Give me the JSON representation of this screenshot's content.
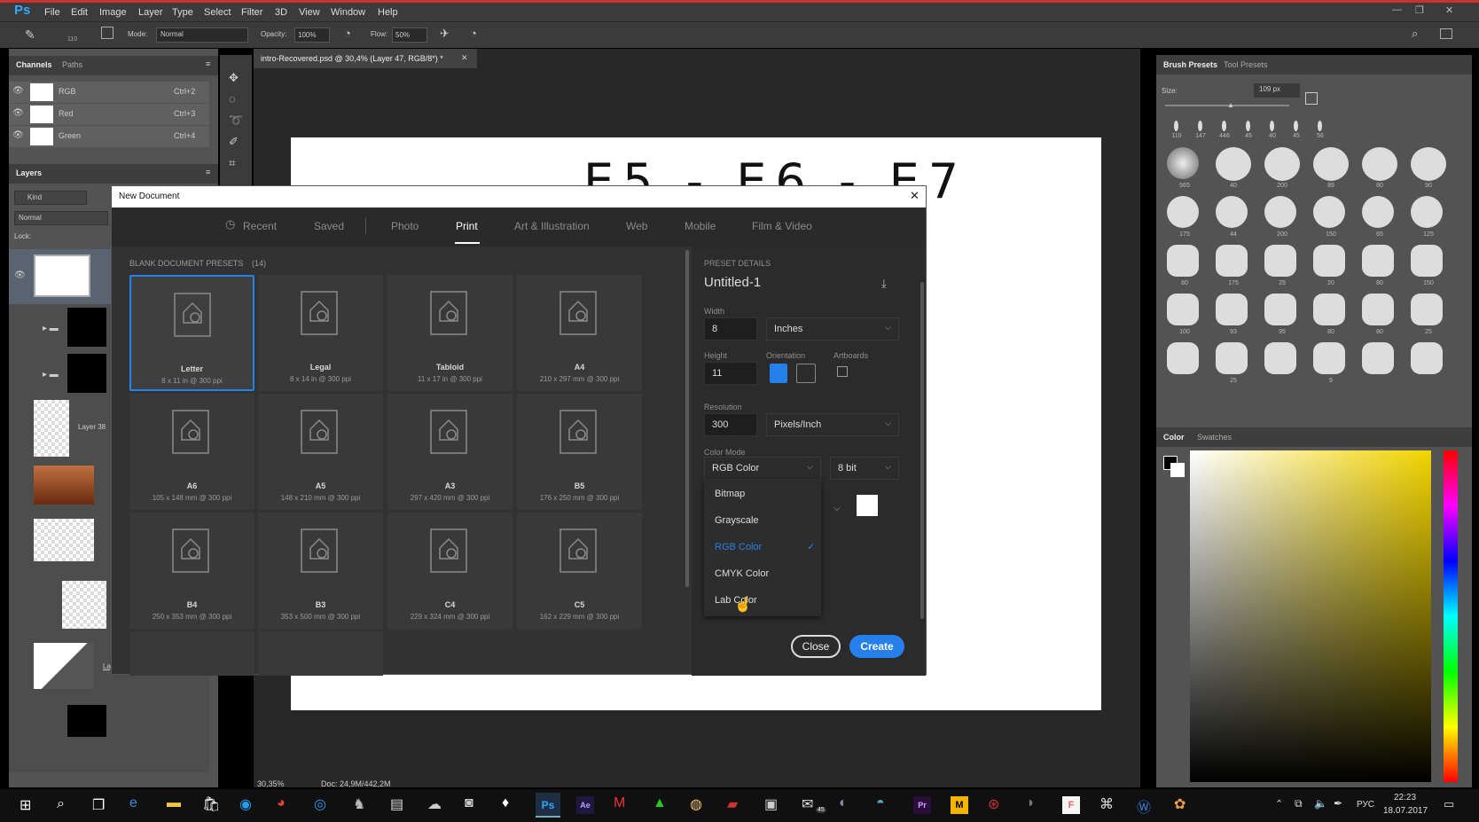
{
  "app": {
    "menu": [
      "File",
      "Edit",
      "Image",
      "Layer",
      "Type",
      "Select",
      "Filter",
      "3D",
      "View",
      "Window",
      "Help"
    ],
    "options": {
      "brush_size": "110",
      "mode_label": "Mode:",
      "mode_value": "Normal",
      "opacity_label": "Opacity:",
      "opacity_value": "100%",
      "flow_label": "Flow:",
      "flow_value": "50%"
    },
    "doc_tab": "intro-Recovered.psd @ 30,4% (Layer 47, RGB/8*) *",
    "status": {
      "zoom": "30,35%",
      "doc": "Doc: 24,9M/442,2M"
    },
    "canvas_text": "E5 - E6 - E7"
  },
  "channels": {
    "tabs": [
      "Channels",
      "Paths"
    ],
    "rows": [
      {
        "name": "RGB",
        "shortcut": "Ctrl+2"
      },
      {
        "name": "Red",
        "shortcut": "Ctrl+3"
      },
      {
        "name": "Green",
        "shortcut": "Ctrl+4"
      }
    ]
  },
  "layers": {
    "title": "Layers",
    "kind": "Kind",
    "blend": "Normal",
    "lock_label": "Lock:",
    "items": [
      "Layer 38",
      "Layer 32"
    ]
  },
  "dialog": {
    "title": "New Document",
    "tabs": [
      "Recent",
      "Saved",
      "Photo",
      "Print",
      "Art & Illustration",
      "Web",
      "Mobile",
      "Film & Video"
    ],
    "active_tab": "Print",
    "presets_heading": "BLANK DOCUMENT PRESETS",
    "presets_count": "(14)",
    "presets": [
      {
        "name": "Letter",
        "dims": "8 x 11 in @ 300 ppi"
      },
      {
        "name": "Legal",
        "dims": "8 x 14 in @ 300 ppi"
      },
      {
        "name": "Tabloid",
        "dims": "11 x 17 in @ 300 ppi"
      },
      {
        "name": "A4",
        "dims": "210 x 297 mm @ 300 ppi"
      },
      {
        "name": "A6",
        "dims": "105 x 148 mm @ 300 ppi"
      },
      {
        "name": "A5",
        "dims": "148 x 210 mm @ 300 ppi"
      },
      {
        "name": "A3",
        "dims": "297 x 420 mm @ 300 ppi"
      },
      {
        "name": "B5",
        "dims": "176 x 250 mm @ 300 ppi"
      },
      {
        "name": "B4",
        "dims": "250 x 353 mm @ 300 ppi"
      },
      {
        "name": "B3",
        "dims": "353 x 500 mm @ 300 ppi"
      },
      {
        "name": "C4",
        "dims": "229 x 324 mm @ 300 ppi"
      },
      {
        "name": "C5",
        "dims": "162 x 229 mm @ 300 ppi"
      }
    ],
    "details": {
      "heading": "PRESET DETAILS",
      "name": "Untitled-1",
      "width_label": "Width",
      "width_value": "8",
      "width_unit": "Inches",
      "height_label": "Height",
      "height_value": "11",
      "orientation_label": "Orientation",
      "artboards_label": "Artboards",
      "resolution_label": "Resolution",
      "resolution_value": "300",
      "resolution_unit": "Pixels/Inch",
      "color_mode_label": "Color Mode",
      "color_mode_value": "RGB Color",
      "bit_depth": "8 bit",
      "color_mode_options": [
        "Bitmap",
        "Grayscale",
        "RGB Color",
        "CMYK Color",
        "Lab Color"
      ],
      "selected_mode": "RGB Color"
    },
    "buttons": {
      "close": "Close",
      "create": "Create"
    }
  },
  "brush_panel": {
    "tabs": [
      "Brush Presets",
      "Tool Presets"
    ],
    "size_label": "Size:",
    "size_value": "109 px",
    "top_row": [
      "110",
      "147",
      "446",
      "45",
      "40",
      "45",
      "56"
    ],
    "grid_nums": [
      [
        "565",
        "40",
        "200",
        "89",
        "80",
        "90"
      ],
      [
        "175",
        "44",
        "200",
        "150",
        "65",
        "125"
      ],
      [
        "80",
        "175",
        "25",
        "20",
        "80",
        "150"
      ],
      [
        "100",
        "93",
        "95",
        "80",
        "80",
        "25"
      ],
      [
        "",
        "25",
        "",
        "9",
        "",
        ""
      ]
    ]
  },
  "color_panel": {
    "tabs": [
      "Color",
      "Swatches"
    ]
  },
  "taskbar": {
    "lang": "РУС",
    "time": "22:23",
    "date": "18.07.2017",
    "mail_badge": "45"
  },
  "colors": {
    "accent": "#2680eb",
    "ps_red": "#cc2f2f",
    "ps_blue": "#31a8ff",
    "dialog_bg": "#323232",
    "panel_bg": "#535353"
  }
}
